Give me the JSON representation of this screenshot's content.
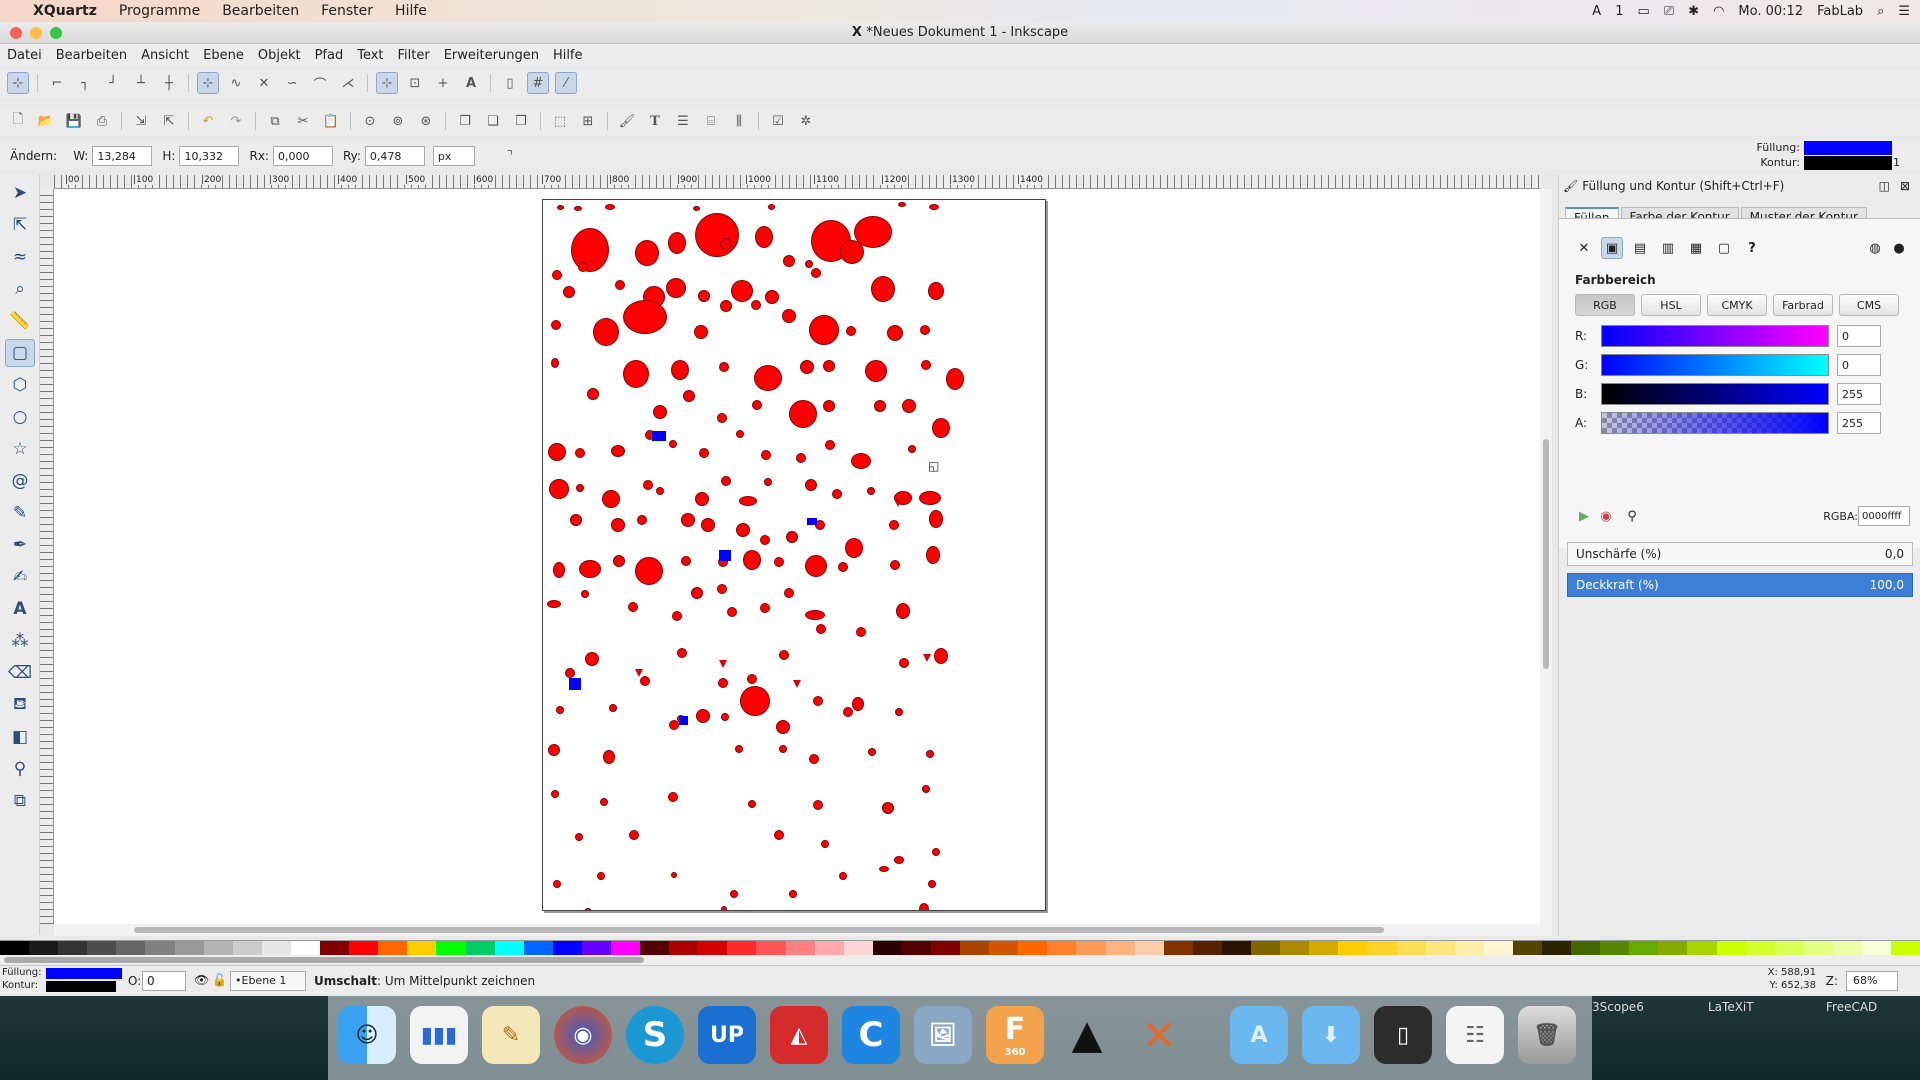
{
  "macbar": {
    "app": "XQuartz",
    "menus": [
      "Programme",
      "Bearbeiten",
      "Fenster",
      "Hilfe"
    ],
    "clock": "Mo. 00:12",
    "user": "FabLab",
    "badge": "1"
  },
  "window": {
    "title": "*Neues Dokument 1 - Inkscape"
  },
  "menubar": [
    "Datei",
    "Bearbeiten",
    "Ansicht",
    "Ebene",
    "Objekt",
    "Pfad",
    "Text",
    "Filter",
    "Erweiterungen",
    "Hilfe"
  ],
  "controls": {
    "label": "Ändern:",
    "w_label": "W:",
    "w": "13,284",
    "h_label": "H:",
    "h": "10,332",
    "rx_label": "Rx:",
    "rx": "0,000",
    "ry_label": "Ry:",
    "ry": "0,478",
    "unit": "px"
  },
  "style_indicator": {
    "fill_label": "Füllung:",
    "stroke_label": "Kontur:",
    "stroke_width": "1",
    "fill_color": "#0000ff",
    "stroke_color": "#000000"
  },
  "ruler_labels": [
    "|00",
    "|100",
    "|200",
    "|300",
    "|400",
    "|500",
    "|600",
    "|700",
    "|800",
    "|900",
    "|1000",
    "|1100",
    "|1200",
    "|1300",
    "|1400"
  ],
  "panel": {
    "title": "Füllung und Kontur (Shift+Ctrl+F)",
    "tabs": [
      "Füllen",
      "Farbe der Kontur",
      "Muster der Kontur"
    ],
    "farbbereich": "Farbbereich",
    "modes": [
      "RGB",
      "HSL",
      "CMYK",
      "Farbrad",
      "CMS"
    ],
    "channels": [
      {
        "label": "R:",
        "value": "0"
      },
      {
        "label": "G:",
        "value": "0"
      },
      {
        "label": "B:",
        "value": "255"
      },
      {
        "label": "A:",
        "value": "255"
      }
    ],
    "rgba_label": "RGBA:",
    "rgba": "0000ffff",
    "blur_label": "Unschärfe (%)",
    "blur": "0,0",
    "opacity_label": "Deckkraft (%)",
    "opacity": "100,0"
  },
  "status": {
    "fill_label": "Füllung:",
    "stroke_label": "Kontur:",
    "opacity_label": "O:",
    "opacity": "0",
    "layer": "•Ebene 1",
    "hint_bold": "Umschalt",
    "hint": ": Um Mittelpunkt zeichnen",
    "x": "X: 588,91",
    "y": "Y: 652,38",
    "zoom_label": "Z:",
    "zoom": "68%"
  },
  "dock": {
    "labels": [
      "3Scope6",
      "LaTeXiT",
      "FreeCAD"
    ],
    "app_360": "360",
    "up": "UP"
  }
}
